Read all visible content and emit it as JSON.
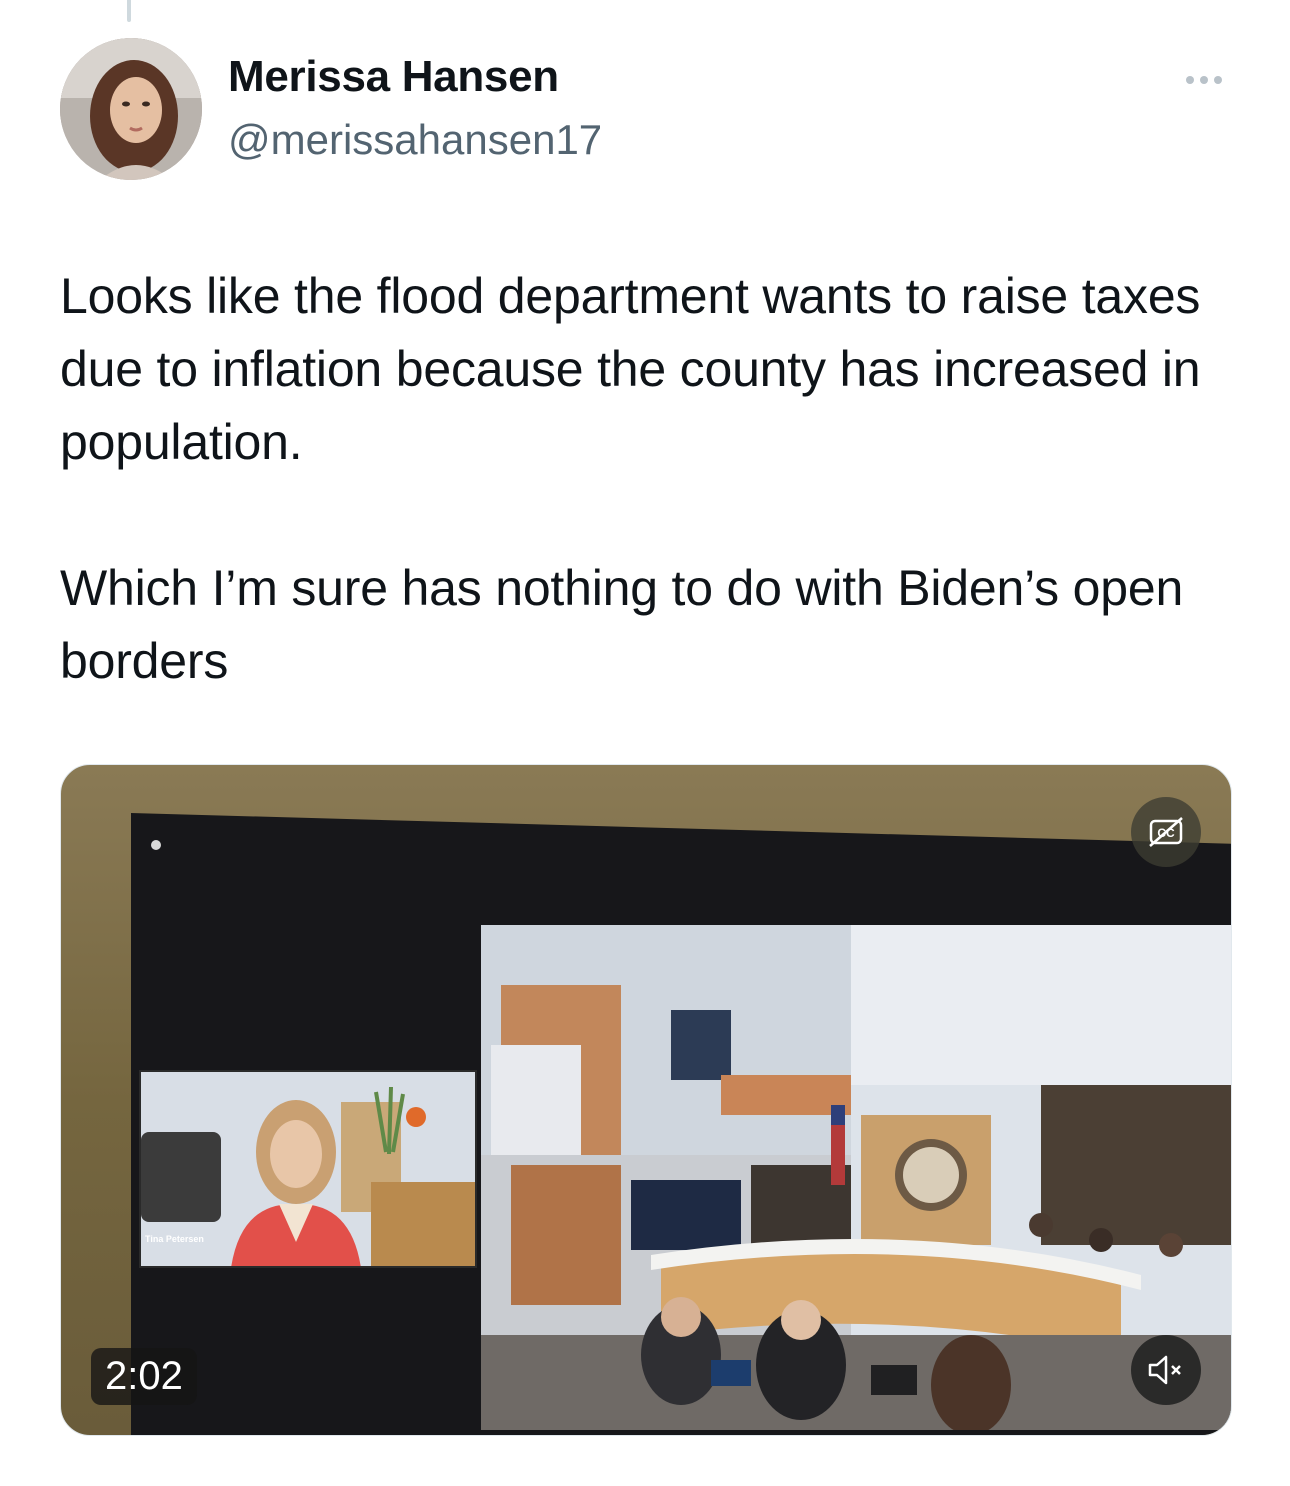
{
  "author": {
    "name": "Merissa Hansen",
    "handle": "@merissahansen17",
    "avatar_icon": "profile-photo"
  },
  "more_icon": "ellipsis-icon",
  "tweet": {
    "paragraphs": [
      "Looks like the flood department wants to raise taxes due to inflation because the county has increased in population.",
      "Which I’m sure has nothing to do with Biden’s open borders"
    ]
  },
  "video": {
    "duration": "2:02",
    "participant_caption": "Tina Petersen",
    "captions_icon": "captions-off-icon",
    "mute_icon": "speaker-muted-icon"
  },
  "colors": {
    "text_primary": "#0f1419",
    "text_secondary": "#536471"
  }
}
